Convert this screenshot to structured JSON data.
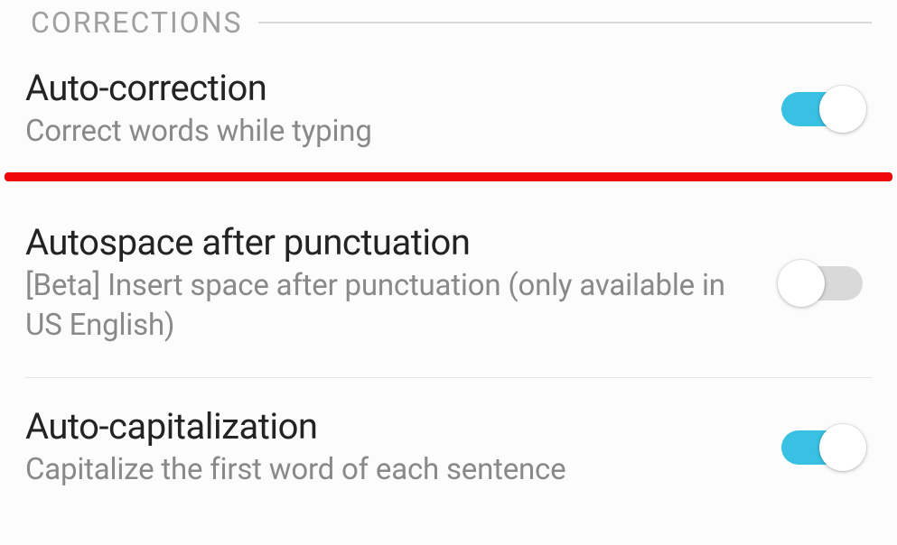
{
  "section": {
    "title": "CORRECTIONS"
  },
  "settings": [
    {
      "title": "Auto-correction",
      "subtitle": "Correct words while typing",
      "enabled": true,
      "highlight": true
    },
    {
      "title": "Autospace after punctuation",
      "subtitle": "[Beta] Insert space after punctuation (only available in US English)",
      "enabled": false,
      "highlight": false
    },
    {
      "title": "Auto-capitalization",
      "subtitle": "Capitalize the first word of each sentence",
      "enabled": true,
      "highlight": false
    }
  ],
  "colors": {
    "accent": "#38c1e2",
    "highlight": "#ee0809"
  }
}
